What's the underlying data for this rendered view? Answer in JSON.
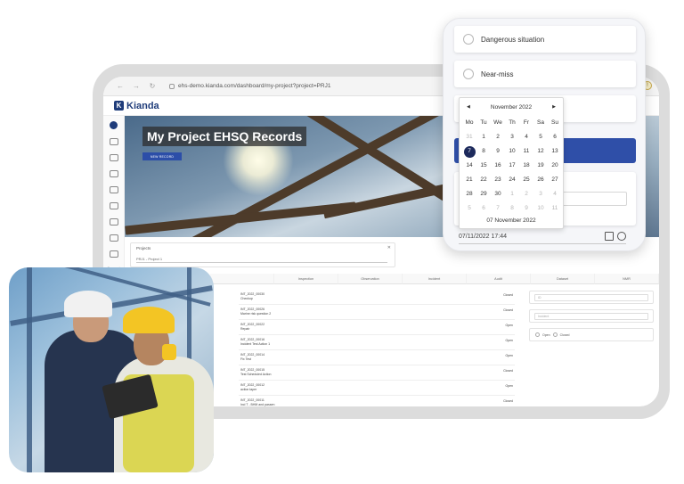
{
  "browser": {
    "url": "ehs-demo.kianda.com/dashboard/my-project?project=PRJ1",
    "nav_icons": [
      "back-icon",
      "forward-icon",
      "refresh-icon"
    ]
  },
  "app": {
    "logo_text": "Kianda"
  },
  "hero": {
    "title": "My Project EHSQ Records",
    "button_label": "NEW RECORD"
  },
  "projects": {
    "label": "Projects",
    "selected": "PRJ1 - Project 1"
  },
  "tabs": [
    "",
    "Inspection",
    "Observation",
    "Incident",
    "Audit",
    "Dataset",
    "NMR"
  ],
  "records": [
    {
      "id": "INT_2022_00030",
      "name": "Checkup",
      "status": "Closed"
    },
    {
      "id": "INT_2022_00026",
      "name": "Marine risk question 2",
      "status": "Closed"
    },
    {
      "id": "INT_2022_00022",
      "name": "Repair",
      "status": "Open"
    },
    {
      "id": "INT_2022_00016",
      "name": "Incident Test Action 1",
      "status": "Open"
    },
    {
      "id": "INT_2022_00014",
      "name": "Fix Test",
      "status": "Open"
    },
    {
      "id": "INT_2022_00015",
      "name": "Test Scheduled Action",
      "status": "Closed"
    },
    {
      "id": "INT_2022_00012",
      "name": "action taper",
      "status": "Open"
    },
    {
      "id": "INT_2022_00011",
      "name": "Incl T - BHM and passen",
      "status": "Closed"
    }
  ],
  "filters": {
    "search_placeholder": "ID",
    "status_placeholder": "Incident",
    "radio_open": "Open",
    "radio_closed": "Closed"
  },
  "phone": {
    "options": [
      "Dangerous situation",
      "Near-miss"
    ],
    "datetime_value": "07/11/2022 17:44"
  },
  "datepicker": {
    "month_label": "November 2022",
    "weekdays": [
      "Mo",
      "Tu",
      "We",
      "Th",
      "Fr",
      "Sa",
      "Su"
    ],
    "days": [
      {
        "d": "31",
        "muted": true
      },
      {
        "d": "1"
      },
      {
        "d": "2"
      },
      {
        "d": "3"
      },
      {
        "d": "4"
      },
      {
        "d": "5"
      },
      {
        "d": "6"
      },
      {
        "d": "7",
        "selected": true
      },
      {
        "d": "8"
      },
      {
        "d": "9"
      },
      {
        "d": "10"
      },
      {
        "d": "11"
      },
      {
        "d": "12"
      },
      {
        "d": "13"
      },
      {
        "d": "14"
      },
      {
        "d": "15"
      },
      {
        "d": "16"
      },
      {
        "d": "17"
      },
      {
        "d": "18"
      },
      {
        "d": "19"
      },
      {
        "d": "20"
      },
      {
        "d": "21"
      },
      {
        "d": "22"
      },
      {
        "d": "23"
      },
      {
        "d": "24"
      },
      {
        "d": "25"
      },
      {
        "d": "26"
      },
      {
        "d": "27"
      },
      {
        "d": "28"
      },
      {
        "d": "29"
      },
      {
        "d": "30"
      },
      {
        "d": "1",
        "muted": true
      },
      {
        "d": "2",
        "muted": true
      },
      {
        "d": "3",
        "muted": true
      },
      {
        "d": "4",
        "muted": true
      },
      {
        "d": "5",
        "muted": true
      },
      {
        "d": "6",
        "muted": true
      },
      {
        "d": "7",
        "muted": true
      },
      {
        "d": "8",
        "muted": true
      },
      {
        "d": "9",
        "muted": true
      },
      {
        "d": "10",
        "muted": true
      },
      {
        "d": "11",
        "muted": true
      }
    ],
    "footer": "07 November 2022"
  },
  "colors": {
    "brand": "#1f3c7a",
    "primary_button": "#2f4fa8",
    "selected_day": "#1d2a5c"
  }
}
